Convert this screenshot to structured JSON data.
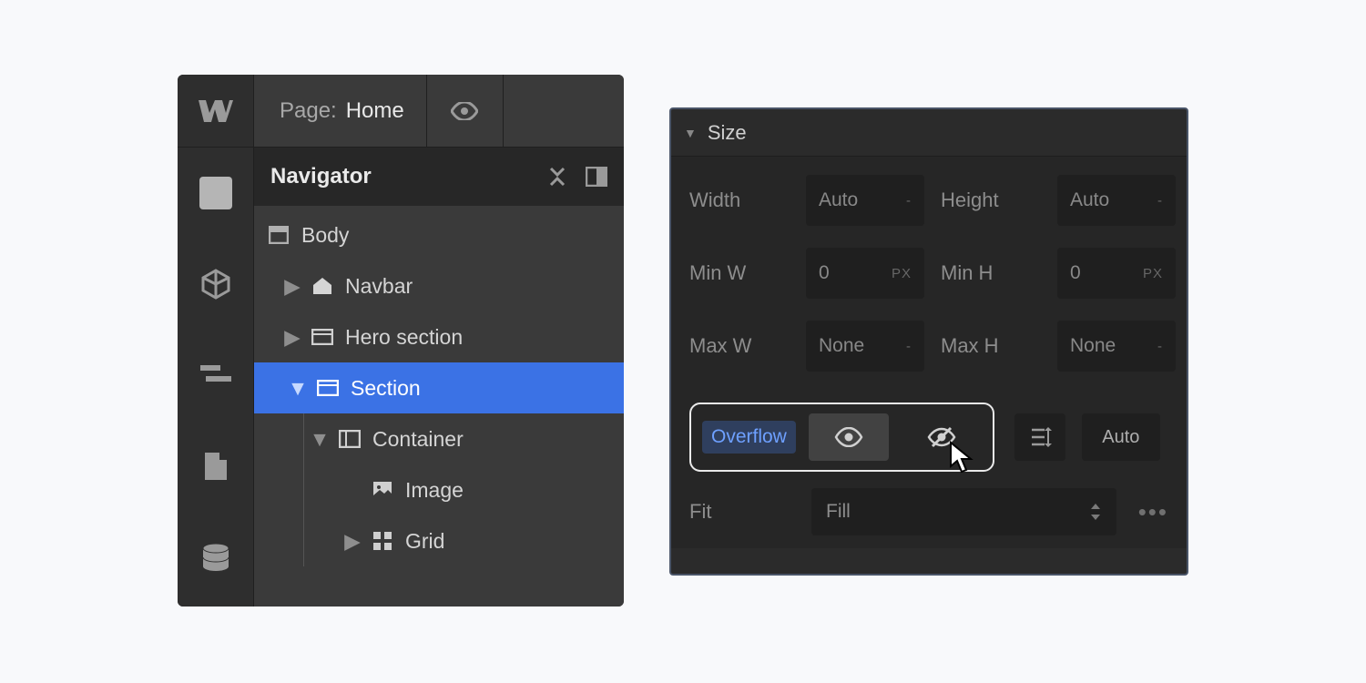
{
  "topbar": {
    "page_label": "Page:",
    "page_name": "Home"
  },
  "navigator": {
    "title": "Navigator",
    "items": [
      {
        "label": "Body"
      },
      {
        "label": "Navbar"
      },
      {
        "label": "Hero section"
      },
      {
        "label": "Section"
      },
      {
        "label": "Container"
      },
      {
        "label": "Image"
      },
      {
        "label": "Grid"
      }
    ]
  },
  "size_panel": {
    "header": "Size",
    "rows": {
      "width_label": "Width",
      "width_value": "Auto",
      "width_unit": "-",
      "height_label": "Height",
      "height_value": "Auto",
      "height_unit": "-",
      "minw_label": "Min W",
      "minw_value": "0",
      "minw_unit": "PX",
      "minh_label": "Min H",
      "minh_value": "0",
      "minh_unit": "PX",
      "maxw_label": "Max W",
      "maxw_value": "None",
      "maxw_unit": "-",
      "maxh_label": "Max H",
      "maxh_value": "None",
      "maxh_unit": "-"
    },
    "overflow_label": "Overflow",
    "auto_label": "Auto",
    "fit_label": "Fit",
    "fit_value": "Fill"
  }
}
